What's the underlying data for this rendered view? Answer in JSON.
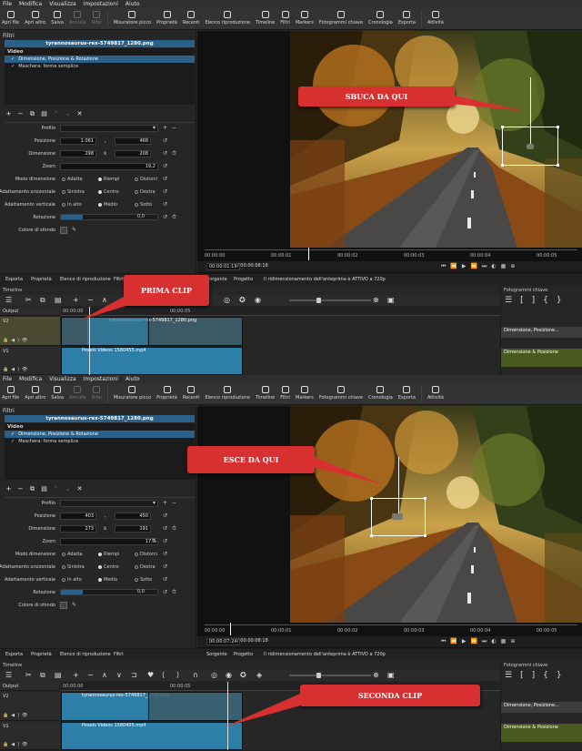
{
  "menu": [
    "File",
    "Modifica",
    "Visualizza",
    "Impostazioni",
    "Aiuto"
  ],
  "toolbar": [
    {
      "label": "Apri file",
      "icon": "folder-icon"
    },
    {
      "label": "Apri altro",
      "icon": "folder-more-icon"
    },
    {
      "label": "Salva",
      "icon": "save-icon"
    },
    {
      "label": "Annulla",
      "icon": "undo-icon",
      "disabled": true
    },
    {
      "label": "Rifai",
      "icon": "redo-icon",
      "disabled": true
    },
    {
      "label": "Misuratore picco",
      "icon": "peak-meter-icon"
    },
    {
      "label": "Proprietà",
      "icon": "info-icon"
    },
    {
      "label": "Recenti",
      "icon": "clock-icon"
    },
    {
      "label": "Elenco riproduzione",
      "icon": "list-icon"
    },
    {
      "label": "Timeline",
      "icon": "timeline-icon"
    },
    {
      "label": "Filtri",
      "icon": "filter-icon"
    },
    {
      "label": "Markers",
      "icon": "marker-icon"
    },
    {
      "label": "Fotogrammi chiave",
      "icon": "stopwatch-icon"
    },
    {
      "label": "Cronologia",
      "icon": "history-icon"
    },
    {
      "label": "Esporta",
      "icon": "export-icon"
    },
    {
      "label": "Attività",
      "icon": "jobs-icon"
    }
  ],
  "filters": {
    "title": "Filtri",
    "clip_name": "tyrannosaurus-rex-5749817_1280.png",
    "list_head": "Video",
    "items": [
      "Dimensione, Posizione & Rotazione",
      "Maschera: forma semplice"
    ],
    "labels": {
      "profile": "Profilo",
      "position": "Posizione",
      "size": "Dimensione",
      "zoom": "Zoom",
      "size_mode": "Modo dimensione",
      "h_align": "Adattamento orizzontale",
      "v_align": "Adattamento verticale",
      "rotation": "Rotazione",
      "bg_color": "Colore di sfondo"
    },
    "options": {
      "size_mode": [
        "Adatta",
        "Riempi",
        "Distorci"
      ],
      "h_align": [
        "Sinistra",
        "Centro",
        "Destra"
      ],
      "v_align": [
        "In alto",
        "Medio",
        "Sotto"
      ]
    }
  },
  "top": {
    "pos_x": "1.061",
    "pos_y": "468",
    "size_w": "298",
    "size_h": "208",
    "zoom": "19,2",
    "rotation": "0,0",
    "tc_current": "00:00:01:19",
    "tc_total": "/ 00:00:08:18",
    "callout_viewer": "SBUCA DA QUI",
    "callout_clip": "PRIMA CLIP"
  },
  "bottom": {
    "pos_x": "403",
    "pos_y": "450",
    "size_w": "273",
    "size_h": "191",
    "zoom": "17,7",
    "zoom_unit": "%",
    "rotation": "0,0",
    "tc_current": "00:00:07:24",
    "tc_total": "/ 00:00:08:18",
    "callout_viewer": "ESCE DA QUI",
    "callout_clip": "SECONDA CLIP"
  },
  "ruler_ticks": [
    "00:00:00",
    "00:00:01",
    "00:00:02",
    "00:00:03",
    "00:00:04",
    "00:00:05"
  ],
  "tabs": {
    "left": [
      "Esporta",
      "Proprietà",
      "Elenco di riproduzione",
      "Filtri"
    ],
    "source": "Sorgente",
    "project": "Progetto",
    "status": "Il ridimensionamento dell'anteprima è ATTIVO a 720p"
  },
  "timeline": {
    "title": "Timeline",
    "kf_title": "Fotogrammi chiave",
    "output": "Output",
    "v2": "V2",
    "v1": "V1",
    "tick0": "00:00:00",
    "tick5": "00:00:05",
    "clip_v2": "tyrannosaurus-rex-5749817_1280.png",
    "clip_v1": "Pexels Videos 1580455.mp4",
    "kf_size": "Dimensione, Posizione...",
    "kf_rot": "Dimensione & Posizione"
  },
  "colors": {
    "accent": "#2b6089",
    "callout": "#d83030",
    "clip": "#2d7fa8"
  }
}
